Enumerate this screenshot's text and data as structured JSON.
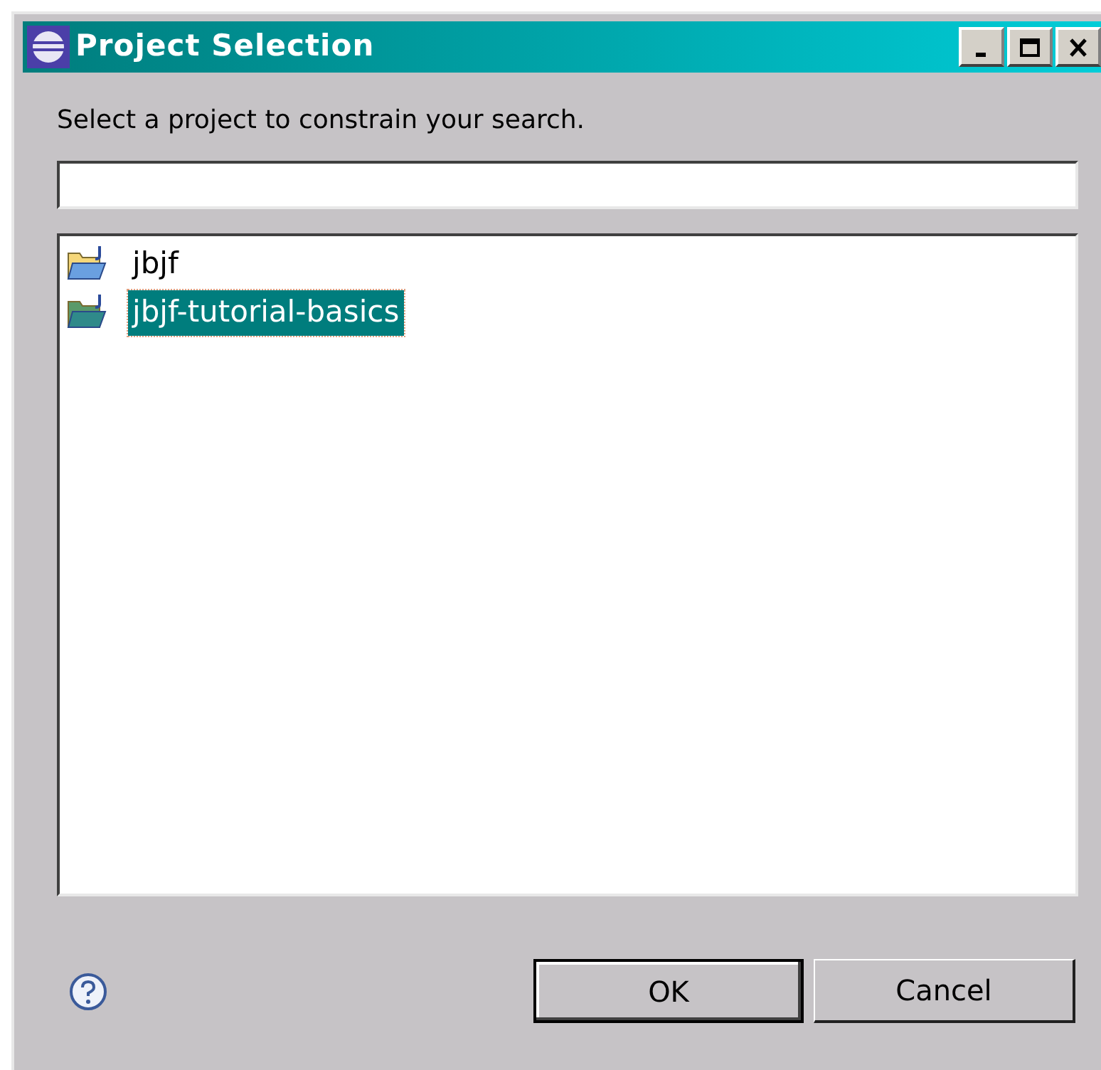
{
  "window": {
    "title": "Project Selection"
  },
  "title_buttons": [
    {
      "kind": "minimize"
    },
    {
      "kind": "maximize"
    },
    {
      "kind": "close"
    }
  ],
  "prompt": "Select a project to constrain your search.",
  "projects": [
    {
      "label": "jbjf",
      "selected": false
    },
    {
      "label": "jbjf-tutorial-basics",
      "selected": true
    }
  ],
  "buttons": [
    {
      "label": "OK",
      "default": true
    },
    {
      "label": "Cancel",
      "default": false
    }
  ]
}
